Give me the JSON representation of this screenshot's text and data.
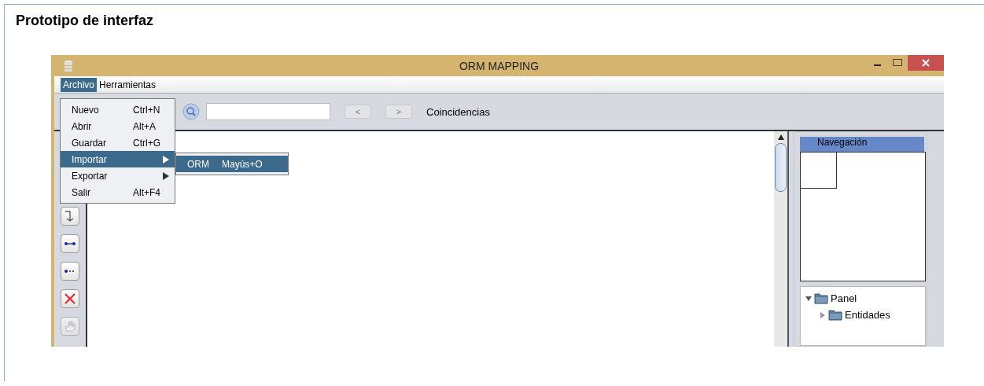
{
  "heading": "Prototipo de interfaz",
  "window": {
    "title": "ORM MAPPING"
  },
  "menubar": [
    {
      "label": "Archivo",
      "selected": true
    },
    {
      "label": "Herramientas",
      "selected": false
    }
  ],
  "menu": [
    {
      "label": "Nuevo",
      "shortcut": "Ctrl+N",
      "selected": false,
      "submenu": false
    },
    {
      "label": "Abrir",
      "shortcut": "Alt+A",
      "selected": false,
      "submenu": false
    },
    {
      "label": "Guardar",
      "shortcut": "Ctrl+G",
      "selected": false,
      "submenu": false
    },
    {
      "label": "Importar",
      "selected": true,
      "submenu": true
    },
    {
      "label": "Exportar",
      "selected": false,
      "submenu": true
    },
    {
      "label": "Salir",
      "shortcut": "Alt+F4",
      "selected": false,
      "submenu": false
    }
  ],
  "submenu": [
    {
      "label": "ORM",
      "shortcut": "Mayús+O",
      "selected": true
    }
  ],
  "search": {
    "prev": "<",
    "next": ">",
    "matches_label": "Coincidencias"
  },
  "tools": [
    {
      "kind": "split",
      "disabled": false
    },
    {
      "kind": "connect",
      "disabled": false
    },
    {
      "kind": "connect-dashed",
      "disabled": false
    },
    {
      "kind": "delete",
      "disabled": false
    },
    {
      "kind": "hand",
      "disabled": true
    }
  ],
  "navigation": {
    "title": "Navegación"
  },
  "tree": [
    {
      "label": "Panel",
      "expanded": true,
      "children": [
        {
          "label": "Entidades",
          "expanded": false
        }
      ]
    }
  ]
}
